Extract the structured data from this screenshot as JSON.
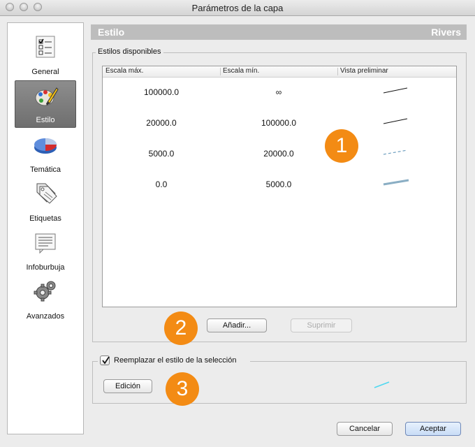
{
  "window": {
    "title": "Parámetros de la capa"
  },
  "sidebar": {
    "items": [
      {
        "label": "General",
        "icon": "checklist-icon",
        "selected": false
      },
      {
        "label": "Estilo",
        "icon": "palette-icon",
        "selected": true
      },
      {
        "label": "Temática",
        "icon": "pie-chart-icon",
        "selected": false
      },
      {
        "label": "Etiquetas",
        "icon": "tags-icon",
        "selected": false
      },
      {
        "label": "Infoburbuja",
        "icon": "notepad-icon",
        "selected": false
      },
      {
        "label": "Avanzados",
        "icon": "gears-icon",
        "selected": false
      }
    ]
  },
  "header": {
    "title": "Estilo",
    "layer": "Rivers"
  },
  "styles_group": {
    "label": "Estilos disponibles",
    "columns": [
      "Escala máx.",
      "Escala mín.",
      "Vista preliminar"
    ],
    "rows": [
      {
        "max": "100000.0",
        "min": "∞",
        "preview": "thin-black-line"
      },
      {
        "max": "20000.0",
        "min": "100000.0",
        "preview": "thin-black-line"
      },
      {
        "max": "5000.0",
        "min": "20000.0",
        "preview": "dashed-blue-line"
      },
      {
        "max": "0.0",
        "min": "5000.0",
        "preview": "thick-gray-blue-line"
      }
    ],
    "add_label": "Añadir...",
    "remove_label": "Suprimir"
  },
  "selection_group": {
    "label": "Reemplazar el estilo de la selección",
    "checked": true,
    "edit_label": "Edición",
    "preview": "cyan-line"
  },
  "footer": {
    "cancel_label": "Cancelar",
    "accept_label": "Aceptar"
  },
  "callouts": [
    "1",
    "2",
    "3"
  ],
  "colors": {
    "accent": "#f38b14",
    "header_bg": "#bdbdbd",
    "selected_nav": "#7a7a7a",
    "preview_blue": "#6f9fc0",
    "preview_cyan": "#4fd8f0"
  }
}
